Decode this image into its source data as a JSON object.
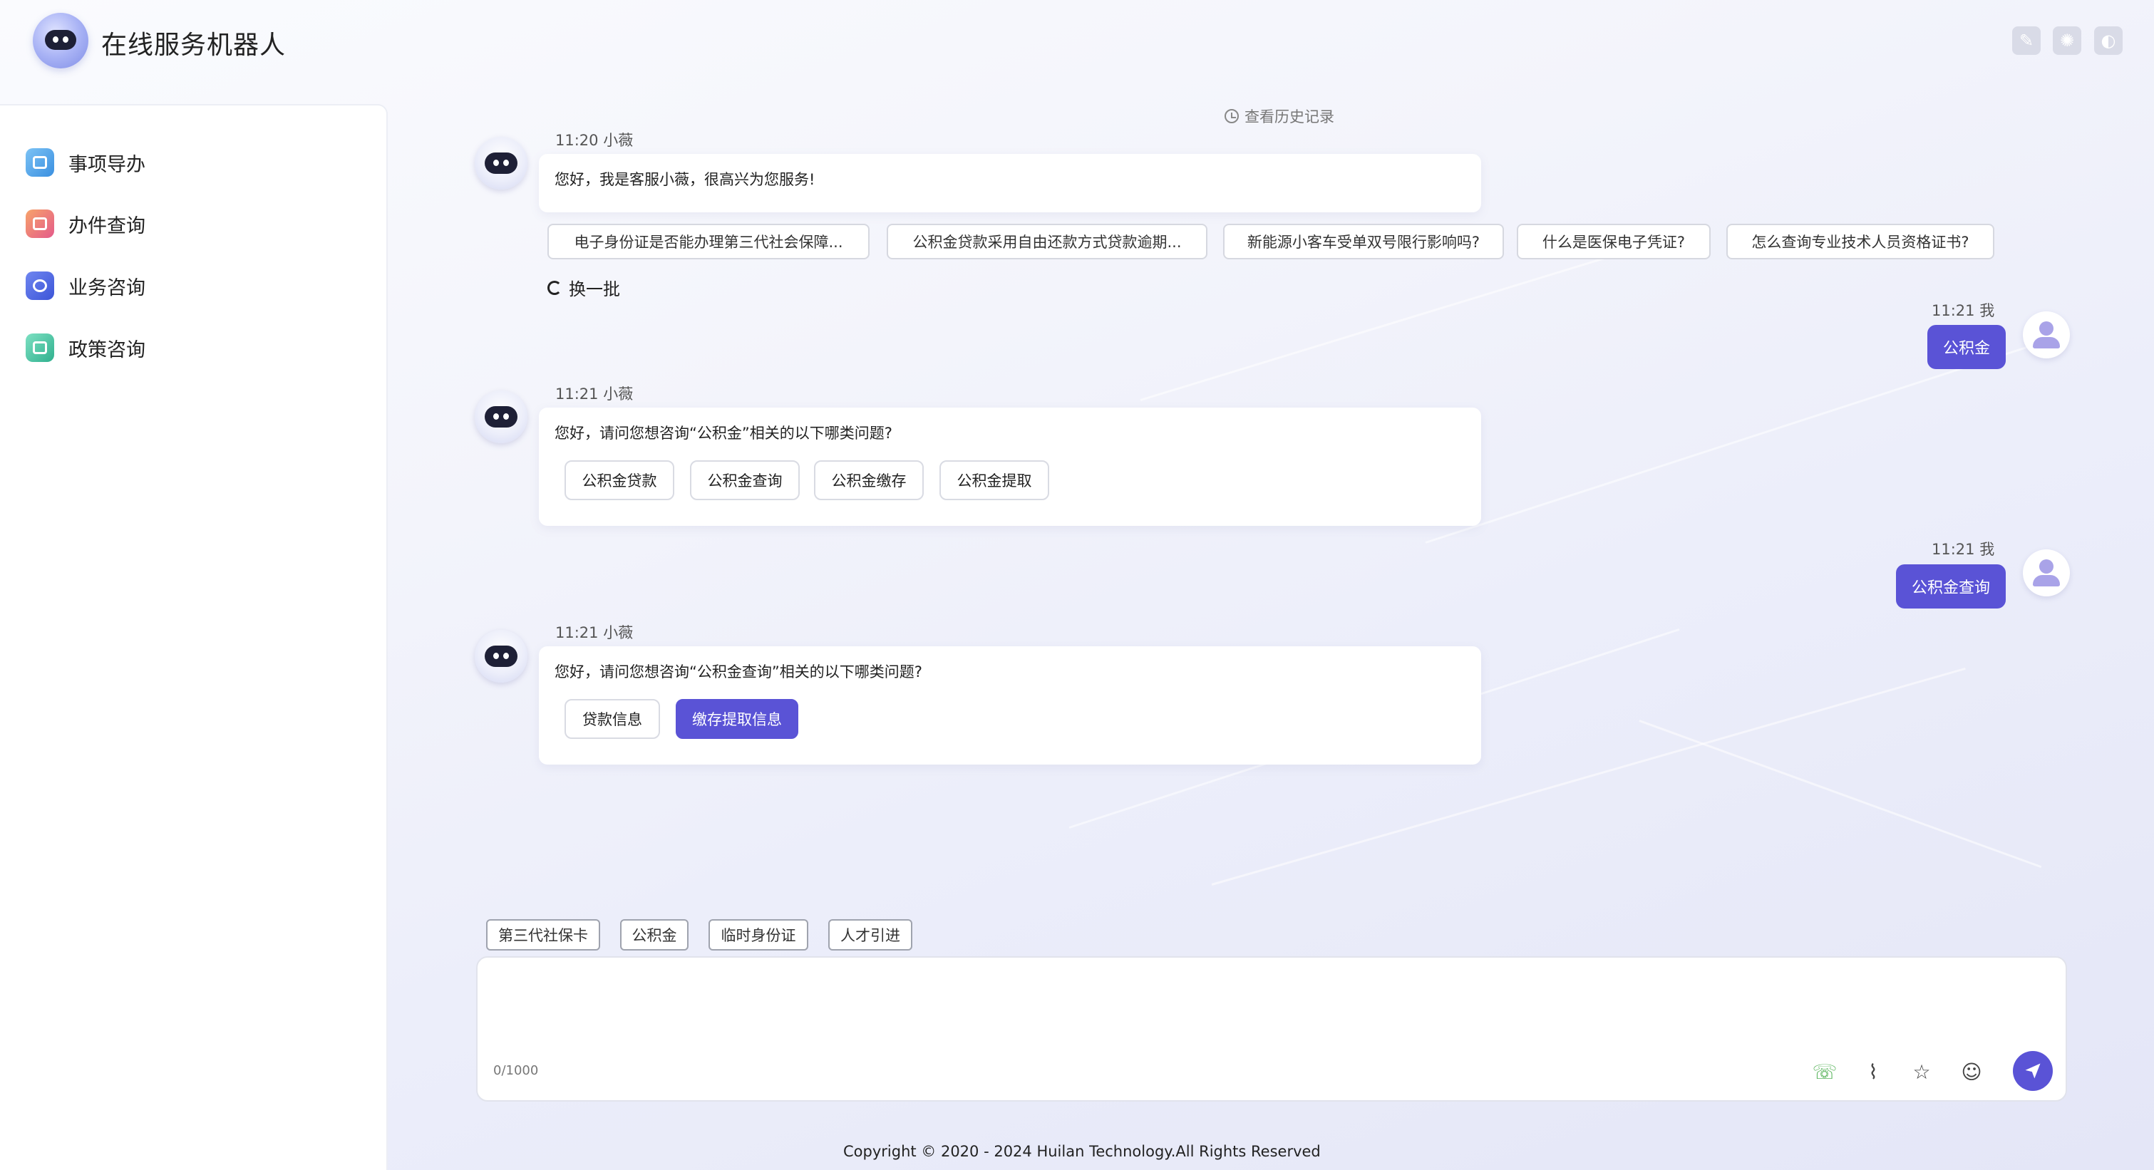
{
  "header": {
    "title": "在线服务机器人",
    "icons": [
      "edit-icon",
      "settings-icon",
      "theme-icon"
    ]
  },
  "sidebar": {
    "items": [
      {
        "label": "事项导办",
        "color": "#4aa3e8"
      },
      {
        "label": "办件查询",
        "color": "#e96b6b"
      },
      {
        "label": "业务咨询",
        "color": "#4f6ee6"
      },
      {
        "label": "政策咨询",
        "color": "#3fc1a0"
      }
    ]
  },
  "chat": {
    "history_link": "查看历史记录",
    "messages": [
      {
        "time": "11:20",
        "sender": "小薇",
        "text": "您好，我是客服小薇，很高兴为您服务!"
      },
      {
        "time": "11:21",
        "sender": "我",
        "text": "公积金"
      },
      {
        "time": "11:21",
        "sender": "小薇",
        "text": "您好，请问您想咨询“公积金”相关的以下哪类问题?",
        "options": [
          "公积金贷款",
          "公积金查询",
          "公积金缴存",
          "公积金提取"
        ]
      },
      {
        "time": "11:21",
        "sender": "我",
        "text": "公积金查询"
      },
      {
        "time": "11:21",
        "sender": "小薇",
        "text": "您好，请问您想咨询“公积金查询”相关的以下哪类问题?",
        "options": [
          "贷款信息",
          "缴存提取信息"
        ],
        "selected": "缴存提取信息"
      }
    ],
    "suggestions": [
      "电子身份证是否能办理第三代社会保障...",
      "公积金贷款采用自由还款方式贷款逾期...",
      "新能源小客车受单双号限行影响吗?",
      "什么是医保电子凭证?",
      "怎么查询专业技术人员资格证书?"
    ],
    "refresh_label": "换一批"
  },
  "quick_tags": [
    "第三代社保卡",
    "公积金",
    "临时身份证",
    "人才引进"
  ],
  "input": {
    "placeholder": "",
    "counter": "0/1000"
  },
  "colors": {
    "accent": "#5a53d6"
  },
  "footer": {
    "copyright": "Copyright © 2020 - 2024 Huilan Technology.All Rights Reserved"
  }
}
